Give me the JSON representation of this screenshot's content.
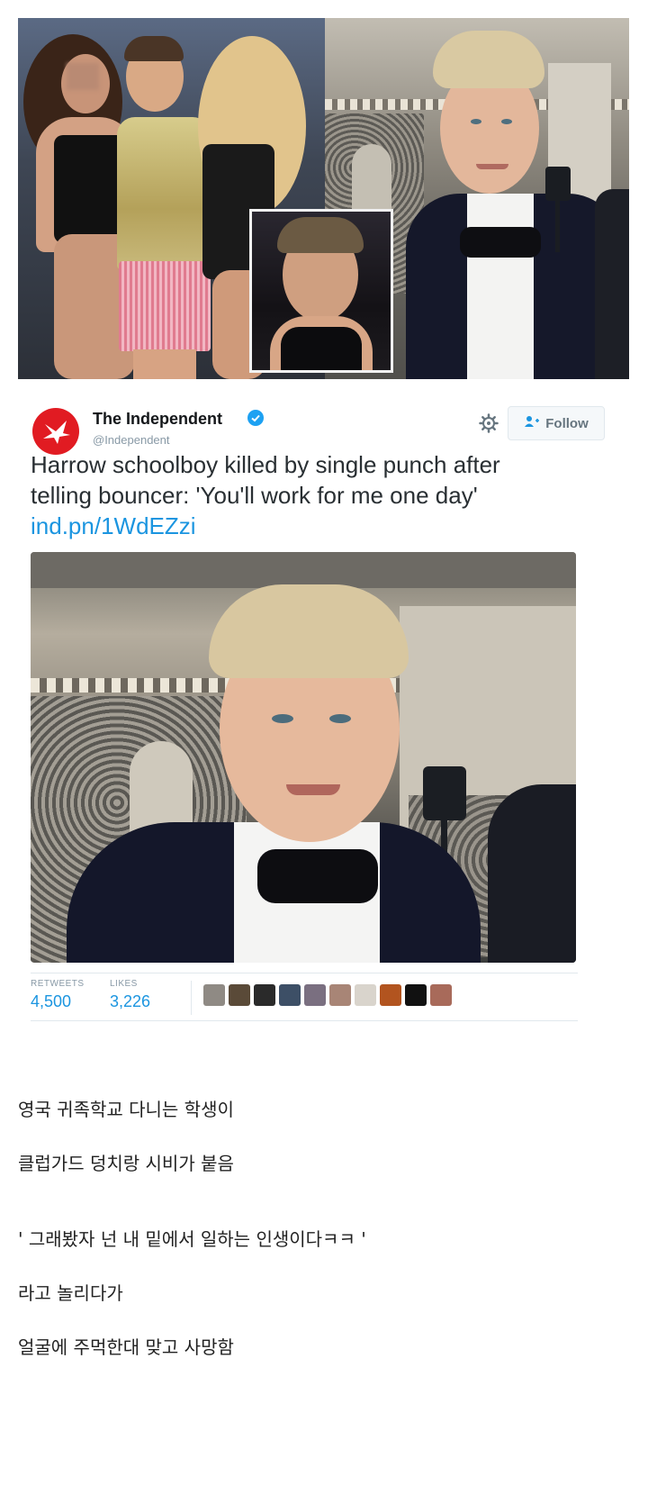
{
  "tweet": {
    "user_name": "The Independent",
    "handle": "@Independent",
    "follow_label": "Follow",
    "text_line1": "Harrow schoolboy killed by single punch after",
    "text_line2": "telling bouncer: 'You'll work for me one day'",
    "link": "ind.pn/1WdEZzi",
    "stats": {
      "retweets_label": "RETWEETS",
      "retweets_value": "4,500",
      "likes_label": "LIKES",
      "likes_value": "3,226"
    }
  },
  "colors": {
    "brand_red": "#e11b22",
    "link_blue": "#1b95e0",
    "verified_blue": "#1da1f2"
  },
  "icons": [
    "eagle-logo-icon",
    "verified-badge-icon",
    "gear-icon",
    "add-user-icon"
  ],
  "caption": {
    "line1": "영국 귀족학교 다니는 학생이",
    "line2": "클럽가드 덩치랑 시비가 붙음",
    "line3": "' 그래봤자 넌 내 밑에서 일하는 인생이다ㅋㅋ '",
    "line4": "라고 놀리다가",
    "line5": "얼굴에 주먹한대 맞고 사망함"
  }
}
